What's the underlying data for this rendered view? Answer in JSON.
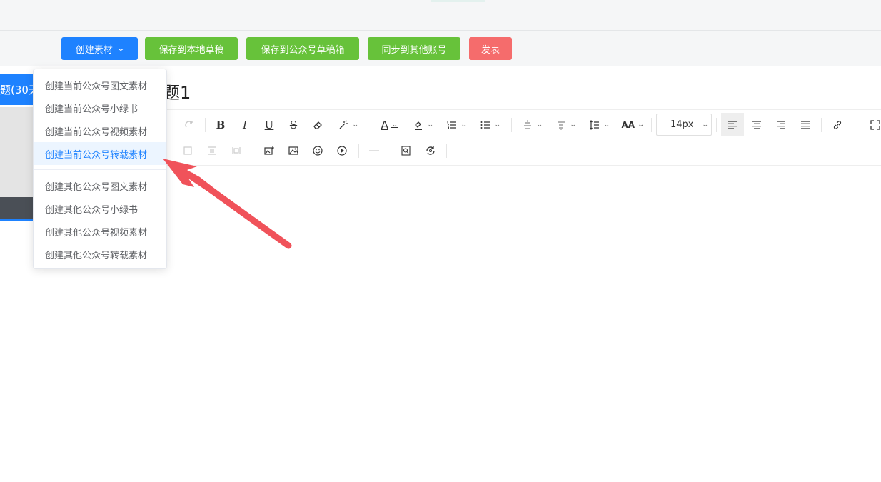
{
  "toolbar": {
    "create_label": "创建素材",
    "save_local_label": "保存到本地草稿",
    "save_mp_label": "保存到公众号草稿箱",
    "sync_label": "同步到其他账号",
    "publish_label": "发表"
  },
  "left_panel": {
    "active_tab_label": "题(30天"
  },
  "editor": {
    "title": "题1",
    "font_size": "14px"
  },
  "dropdown": {
    "current_items": [
      "创建当前公众号图文素材",
      "创建当前公众号小绿书",
      "创建当前公众号视频素材",
      "创建当前公众号转载素材"
    ],
    "other_items": [
      "创建其他公众号图文素材",
      "创建其他公众号小绿书",
      "创建其他公众号视频素材",
      "创建其他公众号转载素材"
    ],
    "highlighted_item": "创建当前公众号转载素材"
  },
  "colors": {
    "primary": "#1e82ff",
    "success": "#67c23a",
    "danger": "#f56c6c",
    "annotation_arrow": "#f0525a"
  },
  "icons": {
    "row1": [
      "redo-icon",
      "bold-icon",
      "italic-icon",
      "underline-icon",
      "strikethrough-icon",
      "eraser-icon",
      "magic-format-icon",
      "font-color-icon",
      "background-color-icon",
      "ordered-list-icon",
      "bullet-list-icon",
      "indent-icon",
      "outdent-icon",
      "line-height-icon",
      "font-family-icon",
      "align-left-icon",
      "align-center-icon",
      "align-right-icon",
      "align-justify-icon",
      "link-icon",
      "fullscreen-icon"
    ],
    "row2": [
      "table-icon",
      "image-upload-icon",
      "image-icon",
      "emoji-icon",
      "video-icon",
      "divider-icon",
      "find-icon",
      "replace-icon"
    ]
  }
}
